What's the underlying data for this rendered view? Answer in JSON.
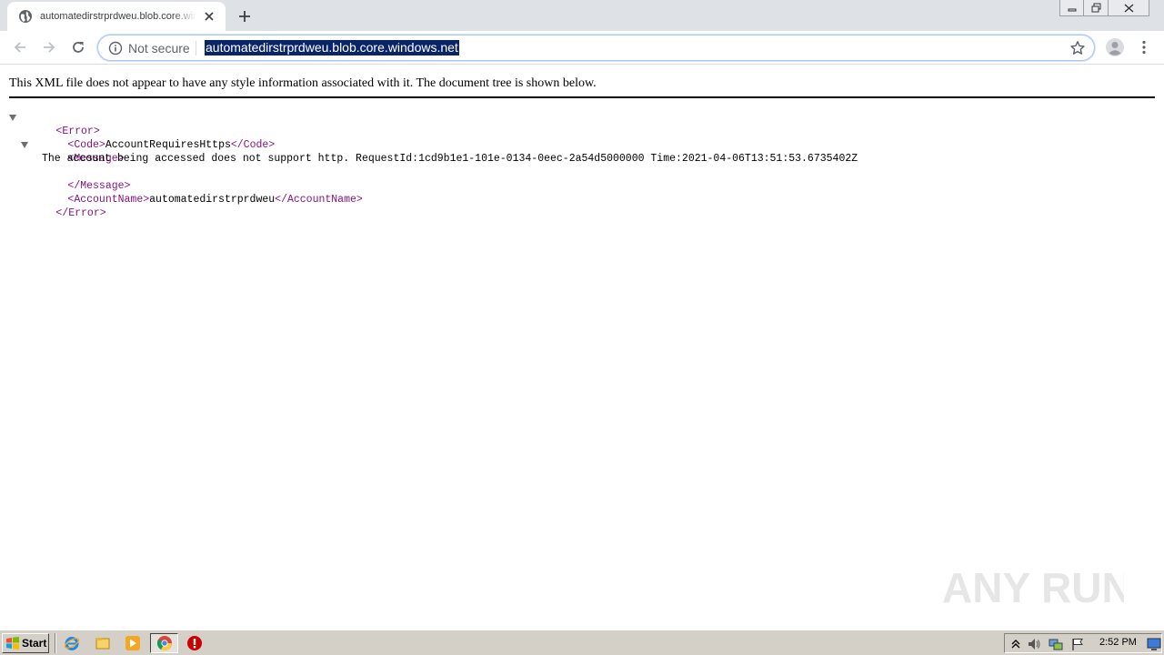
{
  "browser": {
    "tab": {
      "title": "automatedirstrprdweu.blob.core.windows.net",
      "favicon": "globe-icon"
    },
    "new_tab_label": "+",
    "omnibox": {
      "security_label": "Not secure",
      "url": "automatedirstrprdweu.blob.core.windows.net"
    }
  },
  "page": {
    "info_text": "This XML file does not appear to have any style information associated with it. The document tree is shown below.",
    "tree": {
      "error_open": "<Error>",
      "code_open": "<Code>",
      "code_value": "AccountRequiresHttps",
      "code_close": "</Code>",
      "message_open": "<Message>",
      "message_value": "The account being accessed does not support http. RequestId:1cd9b1e1-101e-0134-0eec-2a54d5000000 Time:2021-04-06T13:51:53.6735402Z",
      "message_close": "</Message>",
      "account_open": "<AccountName>",
      "account_value": "automatedirstrprdweu",
      "account_close": "</AccountName>",
      "error_close": "</Error>"
    },
    "watermark": "ANY RUN"
  },
  "taskbar": {
    "start_label": "Start",
    "clock": "2:52 PM",
    "apps": [
      "ie-icon",
      "explorer-icon",
      "media-player-icon",
      "chrome-icon",
      "stop-icon"
    ]
  },
  "colors": {
    "tag": "#881280",
    "url_highlight": "#0a246a",
    "tabstrip": "#dee1e6"
  }
}
